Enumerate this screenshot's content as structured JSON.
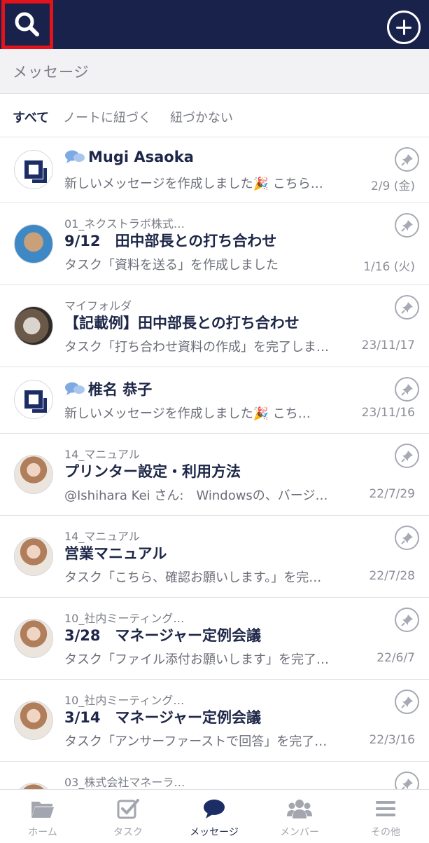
{
  "header": {
    "search_icon": "search-icon",
    "add_icon": "plus-circle-icon"
  },
  "section": {
    "title": "メッセージ"
  },
  "filters": [
    {
      "label": "すべて",
      "active": true
    },
    {
      "label": "ノートに紐づく",
      "active": false
    },
    {
      "label": "紐づかない",
      "active": false
    }
  ],
  "messages": [
    {
      "folder": "",
      "title": "Mugi Asaoka",
      "chat": true,
      "preview": "新しいメッセージを作成しました🎉 こちら…",
      "date": "2/9 (金)",
      "avatar": "logo"
    },
    {
      "folder": "01_ネクストラボ株式…",
      "title": "9/12　田中部長との打ち合わせ",
      "chat": false,
      "preview": "タスク「資料を送る」を作成しました",
      "date": "1/16 (火)",
      "avatar": "photo-a"
    },
    {
      "folder": "マイフォルダ",
      "title": "【記載例】田中部長との打ち合わせ",
      "chat": false,
      "preview": "タスク「打ち合わせ資料の作成」を完了しま…",
      "date": "23/11/17",
      "avatar": "photo-b"
    },
    {
      "folder": "",
      "title": "椎名 恭子",
      "chat": true,
      "preview": "新しいメッセージを作成しました🎉 こち…",
      "date": "23/11/16",
      "avatar": "logo"
    },
    {
      "folder": "14_マニュアル",
      "title": "プリンター設定・利用方法",
      "chat": false,
      "preview": "@Ishihara Kei さん:　Windowsの、バージ…",
      "date": "22/7/29",
      "avatar": "photo-c"
    },
    {
      "folder": "14_マニュアル",
      "title": "営業マニュアル",
      "chat": false,
      "preview": "タスク「こちら、確認お願いします。」を完…",
      "date": "22/7/28",
      "avatar": "photo-c"
    },
    {
      "folder": "10_社内ミーティング…",
      "title": "3/28　マネージャー定例会議",
      "chat": false,
      "preview": "タスク「ファイル添付お願いします」を完了…",
      "date": "22/6/7",
      "avatar": "photo-c"
    },
    {
      "folder": "10_社内ミーティング…",
      "title": "3/14　マネージャー定例会議",
      "chat": false,
      "preview": "タスク「アンサーファーストで回答」を完了…",
      "date": "22/3/16",
      "avatar": "photo-c"
    },
    {
      "folder": "03_株式会社マネーラ…",
      "title": "",
      "chat": false,
      "preview": "",
      "date": "",
      "avatar": "photo-c"
    }
  ],
  "tabs": [
    {
      "label": "ホーム",
      "icon": "folder-icon",
      "active": false
    },
    {
      "label": "タスク",
      "icon": "task-checkbox-icon",
      "active": false
    },
    {
      "label": "メッセージ",
      "icon": "chat-bubble-icon",
      "active": true
    },
    {
      "label": "メンバー",
      "icon": "members-icon",
      "active": false
    },
    {
      "label": "その他",
      "icon": "menu-icon",
      "active": false
    }
  ],
  "colors": {
    "navy": "#18224a",
    "highlight": "#e3131c",
    "text": "#1e2748",
    "muted": "#7a7d86"
  }
}
